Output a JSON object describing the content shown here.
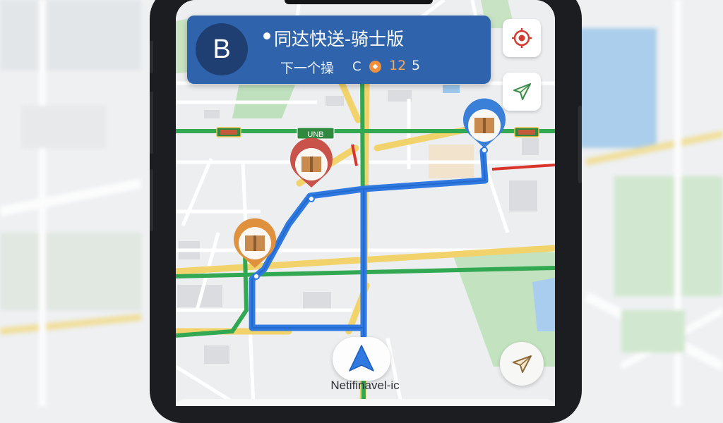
{
  "nav_card": {
    "destination_badge": "B",
    "app_title": "同达快送-骑士版",
    "next_step_label": "下一个操",
    "turn_symbol": "C",
    "orange_badge_value": "12",
    "secondary_value": "5"
  },
  "road_signs": [
    "UNB"
  ],
  "bottom": {
    "caption": "Netifinavel-ic"
  },
  "colors": {
    "card": "#2f64ad",
    "route": "#2f79e0",
    "road_yellow": "#f2d36b",
    "road_green": "#33a852",
    "pin_red": "#c9534a",
    "pin_orange": "#e0913e",
    "pin_blue": "#3a80d8"
  },
  "icons": [
    "locate-target-icon",
    "compass-arrow-icon",
    "navigation-arrow-icon",
    "recenter-arrow-icon",
    "package-icon"
  ]
}
